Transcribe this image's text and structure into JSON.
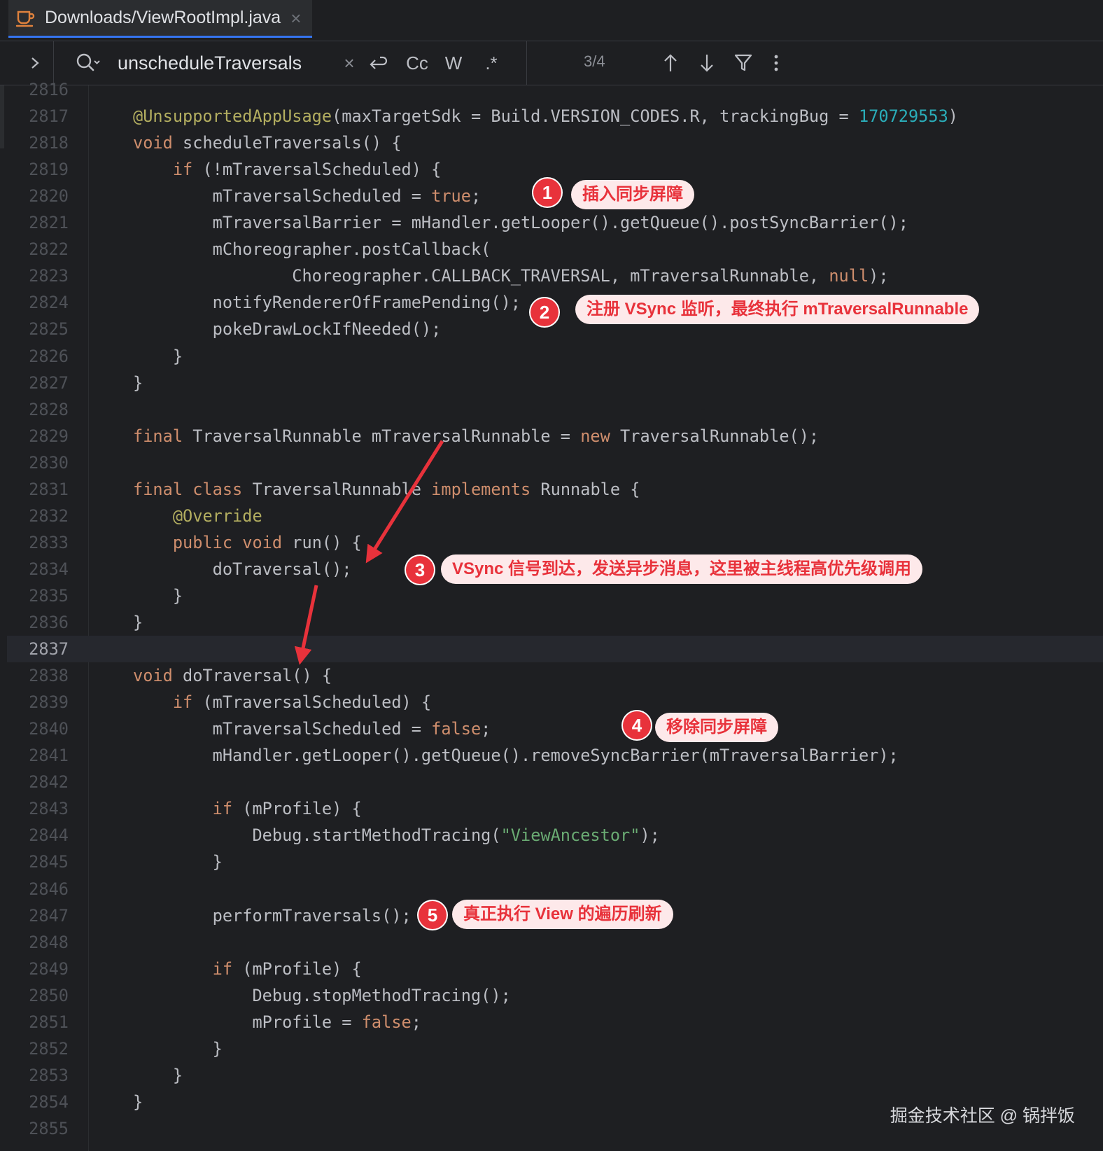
{
  "tab": {
    "title": "Downloads/ViewRootImpl.java",
    "close": "×"
  },
  "search": {
    "query": "unscheduleTraversals",
    "clear": "×",
    "case_label": "Cc",
    "word_label": "W",
    "regex_label": ".*",
    "match_count": "3/4"
  },
  "icons": {
    "file": "java-file-icon",
    "expand": "chevron-right-icon",
    "search": "search-icon",
    "newline": "newline-icon",
    "up": "arrow-up-icon",
    "down": "arrow-down-icon",
    "filter": "filter-icon",
    "more": "more-vertical-icon"
  },
  "colors": {
    "background": "#1e1f22",
    "keyword": "#cf8e6d",
    "annotation": "#b3ae60",
    "number": "#2aacb8",
    "string": "#6aab73",
    "callout_red": "#e8323b",
    "callout_bg": "#fde9ea"
  },
  "current_line": "2837",
  "code_lines": [
    {
      "n": "2816",
      "t": []
    },
    {
      "n": "2817",
      "t": [
        [
          "ann",
          "@UnsupportedAppUsage"
        ],
        [
          "p",
          "(maxTargetSdk = Build.VERSION_CODES.R, trackingBug = "
        ],
        [
          "num",
          "170729553"
        ],
        [
          "p",
          ")"
        ]
      ]
    },
    {
      "n": "2818",
      "t": [
        [
          "kw",
          "void "
        ],
        [
          "p",
          "scheduleTraversals() {"
        ]
      ]
    },
    {
      "n": "2819",
      "t": [
        [
          "p",
          "    "
        ],
        [
          "kw",
          "if "
        ],
        [
          "p",
          "(!mTraversalScheduled) {"
        ]
      ]
    },
    {
      "n": "2820",
      "t": [
        [
          "p",
          "        mTraversalScheduled = "
        ],
        [
          "kw",
          "true"
        ],
        [
          "p",
          ";"
        ]
      ]
    },
    {
      "n": "2821",
      "t": [
        [
          "p",
          "        mTraversalBarrier = mHandler.getLooper().getQueue().postSyncBarrier();"
        ]
      ]
    },
    {
      "n": "2822",
      "t": [
        [
          "p",
          "        mChoreographer.postCallback("
        ]
      ]
    },
    {
      "n": "2823",
      "t": [
        [
          "p",
          "                Choreographer.CALLBACK_TRAVERSAL, mTraversalRunnable, "
        ],
        [
          "kw",
          "null"
        ],
        [
          "p",
          ");"
        ]
      ]
    },
    {
      "n": "2824",
      "t": [
        [
          "p",
          "        notifyRendererOfFramePending();"
        ]
      ]
    },
    {
      "n": "2825",
      "t": [
        [
          "p",
          "        pokeDrawLockIfNeeded();"
        ]
      ]
    },
    {
      "n": "2826",
      "t": [
        [
          "p",
          "    }"
        ]
      ]
    },
    {
      "n": "2827",
      "t": [
        [
          "p",
          "}"
        ]
      ]
    },
    {
      "n": "2828",
      "t": []
    },
    {
      "n": "2829",
      "t": [
        [
          "kw",
          "final "
        ],
        [
          "p",
          "TraversalRunnable mTraversalRunnable = "
        ],
        [
          "kw",
          "new "
        ],
        [
          "p",
          "TraversalRunnable();"
        ]
      ]
    },
    {
      "n": "2830",
      "t": []
    },
    {
      "n": "2831",
      "t": [
        [
          "kw",
          "final class "
        ],
        [
          "p",
          "TraversalRunnable "
        ],
        [
          "kw",
          "implements "
        ],
        [
          "p",
          "Runnable {"
        ]
      ]
    },
    {
      "n": "2832",
      "t": [
        [
          "p",
          "    "
        ],
        [
          "ann",
          "@Override"
        ]
      ]
    },
    {
      "n": "2833",
      "t": [
        [
          "p",
          "    "
        ],
        [
          "kw",
          "public void "
        ],
        [
          "p",
          "run() {"
        ]
      ]
    },
    {
      "n": "2834",
      "t": [
        [
          "p",
          "        doTraversal();"
        ]
      ]
    },
    {
      "n": "2835",
      "t": [
        [
          "p",
          "    }"
        ]
      ]
    },
    {
      "n": "2836",
      "t": [
        [
          "p",
          "}"
        ]
      ]
    },
    {
      "n": "2837",
      "t": []
    },
    {
      "n": "2838",
      "t": [
        [
          "kw",
          "void "
        ],
        [
          "p",
          "doTraversal() {"
        ]
      ]
    },
    {
      "n": "2839",
      "t": [
        [
          "p",
          "    "
        ],
        [
          "kw",
          "if "
        ],
        [
          "p",
          "(mTraversalScheduled) {"
        ]
      ]
    },
    {
      "n": "2840",
      "t": [
        [
          "p",
          "        mTraversalScheduled = "
        ],
        [
          "kw",
          "false"
        ],
        [
          "p",
          ";"
        ]
      ]
    },
    {
      "n": "2841",
      "t": [
        [
          "p",
          "        mHandler.getLooper().getQueue().removeSyncBarrier(mTraversalBarrier);"
        ]
      ]
    },
    {
      "n": "2842",
      "t": []
    },
    {
      "n": "2843",
      "t": [
        [
          "p",
          "        "
        ],
        [
          "kw",
          "if "
        ],
        [
          "p",
          "(mProfile) {"
        ]
      ]
    },
    {
      "n": "2844",
      "t": [
        [
          "p",
          "            Debug.startMethodTracing("
        ],
        [
          "str",
          "\"ViewAncestor\""
        ],
        [
          "p",
          ");"
        ]
      ]
    },
    {
      "n": "2845",
      "t": [
        [
          "p",
          "        }"
        ]
      ]
    },
    {
      "n": "2846",
      "t": []
    },
    {
      "n": "2847",
      "t": [
        [
          "p",
          "        performTraversals();"
        ]
      ]
    },
    {
      "n": "2848",
      "t": []
    },
    {
      "n": "2849",
      "t": [
        [
          "p",
          "        "
        ],
        [
          "kw",
          "if "
        ],
        [
          "p",
          "(mProfile) {"
        ]
      ]
    },
    {
      "n": "2850",
      "t": [
        [
          "p",
          "            Debug.stopMethodTracing();"
        ]
      ]
    },
    {
      "n": "2851",
      "t": [
        [
          "p",
          "            mProfile = "
        ],
        [
          "kw",
          "false"
        ],
        [
          "p",
          ";"
        ]
      ]
    },
    {
      "n": "2852",
      "t": [
        [
          "p",
          "        }"
        ]
      ]
    },
    {
      "n": "2853",
      "t": [
        [
          "p",
          "    }"
        ]
      ]
    },
    {
      "n": "2854",
      "t": [
        [
          "p",
          "}"
        ]
      ]
    },
    {
      "n": "2855",
      "t": []
    }
  ],
  "annotations": [
    {
      "num": "1",
      "text": "插入同步屏障"
    },
    {
      "num": "2",
      "text": "注册 VSync 监听，最终执行 mTraversalRunnable"
    },
    {
      "num": "3",
      "text": "VSync 信号到达，发送异步消息，这里被主线程高优先级调用"
    },
    {
      "num": "4",
      "text": "移除同步屏障"
    },
    {
      "num": "5",
      "text": "真正执行 View 的遍历刷新"
    }
  ],
  "watermark": "掘金技术社区 @ 锅拌饭"
}
